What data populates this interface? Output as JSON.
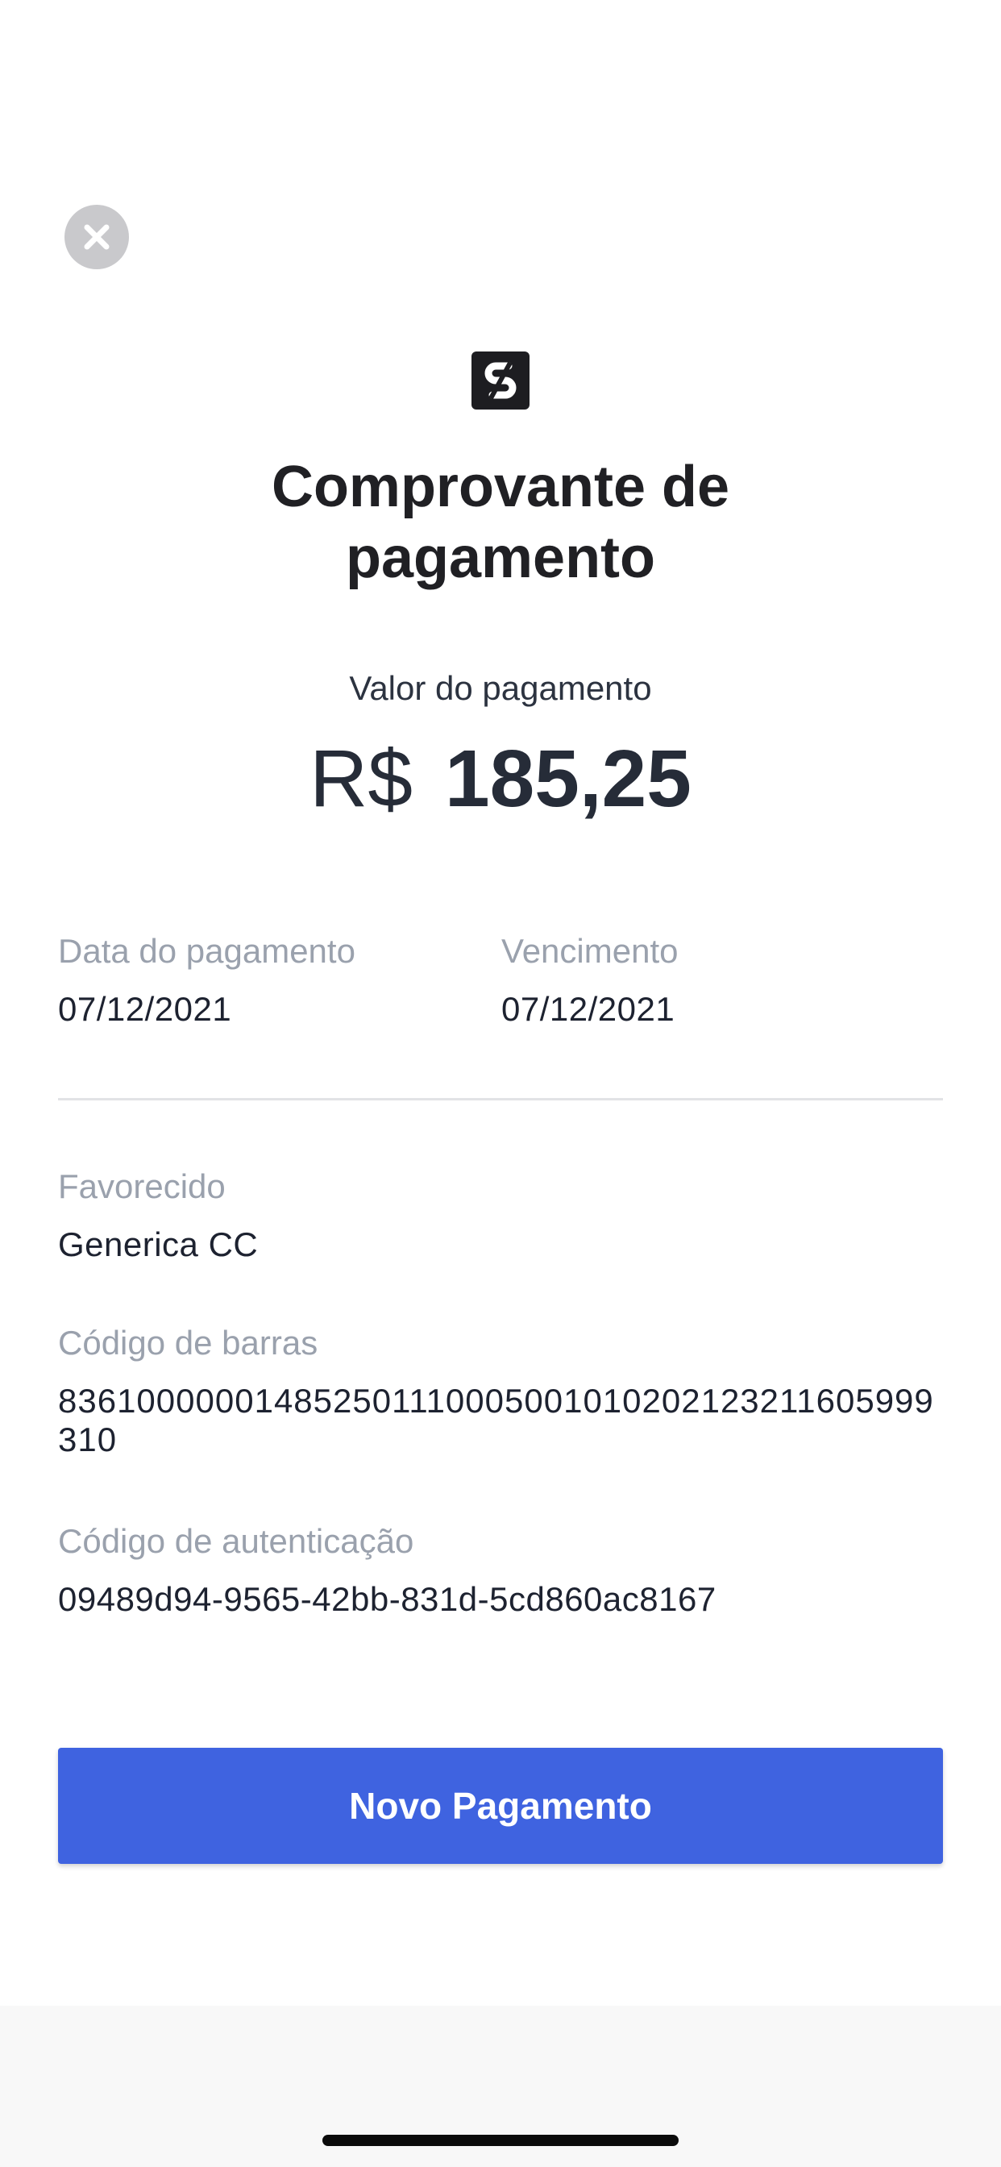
{
  "header": {
    "close_icon": "close-circle-icon",
    "logo_icon": "brand-logo-icon",
    "title": "Comprovante de\npagamento"
  },
  "amount": {
    "label": "Valor do pagamento",
    "currency": "R$",
    "value": "185,25"
  },
  "dates": {
    "payment_date_label": "Data do pagamento",
    "payment_date_value": "07/12/2021",
    "due_date_label": "Vencimento",
    "due_date_value": "07/12/2021"
  },
  "details": {
    "beneficiary_label": "Favorecido",
    "beneficiary_value": "Generica CC",
    "barcode_label": "Código de barras",
    "barcode_value": "836100000014852501110005001010202123211605999310",
    "auth_label": "Código de autenticação",
    "auth_value": "09489d94-9565-42bb-831d-5cd860ac8167"
  },
  "actions": {
    "new_payment_label": "Novo Pagamento"
  },
  "colors": {
    "primary": "#3f63e0",
    "label_gray": "#9aa1ad",
    "close_gray": "#c9c9cc"
  }
}
